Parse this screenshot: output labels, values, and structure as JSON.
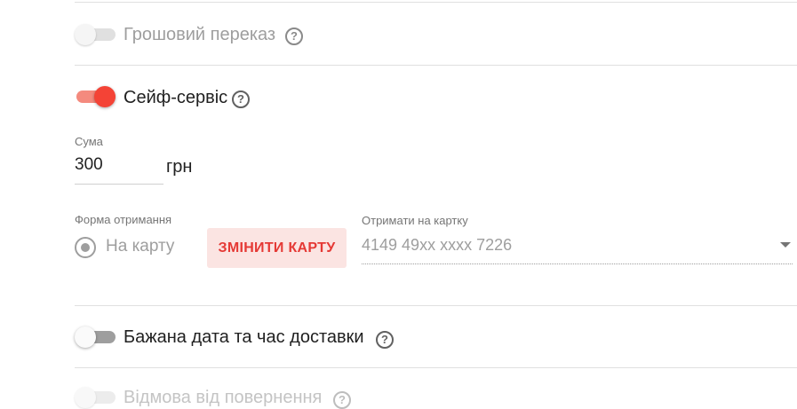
{
  "money_transfer": {
    "label": "Грошовий переказ",
    "help": "?"
  },
  "safe_service": {
    "label": "Сейф-сервіс",
    "help": "?"
  },
  "amount": {
    "caption": "Сума",
    "value": "300",
    "currency": "грн"
  },
  "receive_form": {
    "caption": "Форма отримання",
    "option_label": "На карту",
    "change_button": "ЗМІНИТИ КАРТУ"
  },
  "card_select": {
    "caption": "Отримати на картку",
    "value": "4149 49xx xxxx 7226"
  },
  "delivery_datetime": {
    "label": "Бажана дата та час доставки",
    "help": "?"
  },
  "return_refusal": {
    "label": "Відмова від повернення",
    "help": "?"
  },
  "colors": {
    "accent": "#f44336",
    "accent_light": "#fbe4e2",
    "disabled": "#9e9e9e"
  }
}
